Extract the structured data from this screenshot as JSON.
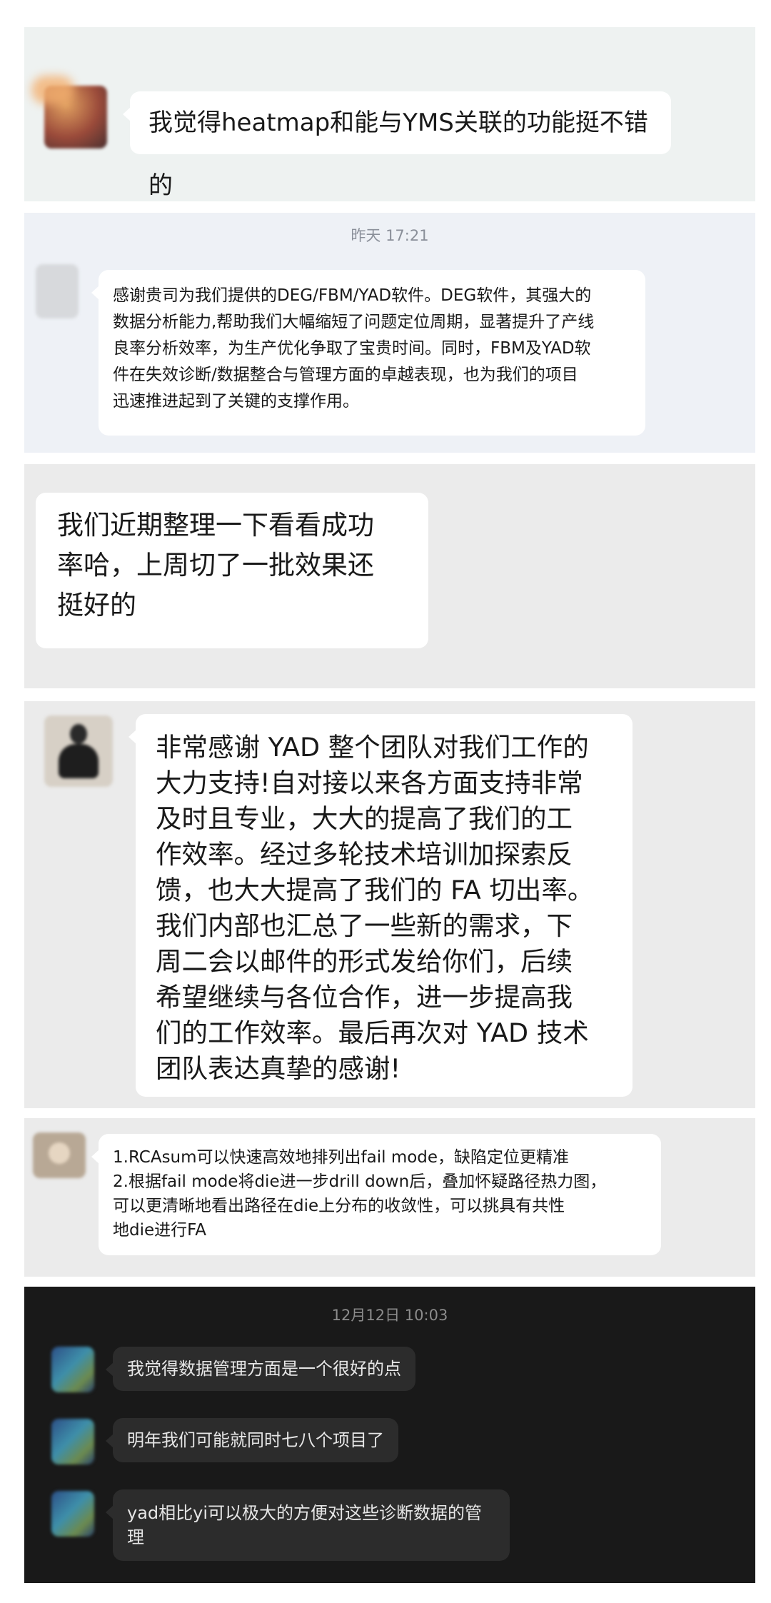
{
  "messages": {
    "m1": "我觉得heatmap和能与YMS关联的功能挺不错的",
    "ts1": "昨天 17:21",
    "m2": "感谢贵司为我们提供的DEG/FBM/YAD软件。DEG软件，其强大的\n数据分析能力,帮助我们大幅缩短了问题定位周期，显著提升了产线\n良率分析效率，为生产优化争取了宝贵时间。同时，FBM及YAD软\n件在失效诊断/数据整合与管理方面的卓越表现，也为我们的项目\n迅速推进起到了关键的支撑作用。",
    "m3": "我们近期整理一下看看成功\n率哈，上周切了一批效果还\n挺好的",
    "m4": "非常感谢 YAD 整个团队对我们工作的\n大力支持!自对接以来各方面支持非常\n及时且专业，大大的提高了我们的工\n作效率。经过多轮技术培训加探索反\n馈，也大大提高了我们的 FA 切出率。\n我们内部也汇总了一些新的需求，下\n周二会以邮件的形式发给你们，后续\n希望继续与各位合作，进一步提高我\n们的工作效率。最后再次对 YAD 技术\n团队表达真挚的感谢!",
    "m5": "1.RCAsum可以快速高效地排列出fail mode，缺陷定位更精准\n2.根据fail mode将die进一步drill down后，叠加怀疑路径热力图，\n可以更清晰地看出路径在die上分布的收敛性，可以挑具有共性\n地die进行FA",
    "ts2": "12月12日 10:03",
    "m6": "我觉得数据管理方面是一个很好的点",
    "m7": "明年我们可能就同时七八个项目了",
    "m8": "yad相比yi可以极大的方便对这些诊断数据的管\n理"
  }
}
